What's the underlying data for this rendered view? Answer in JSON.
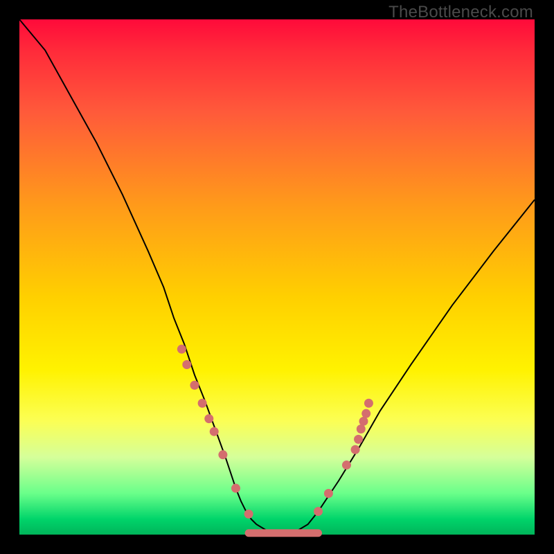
{
  "watermark": "TheBottleneck.com",
  "chart_data": {
    "type": "line",
    "title": "",
    "xlabel": "",
    "ylabel": "",
    "xlim": [
      0,
      100
    ],
    "ylim": [
      0,
      100
    ],
    "grid": false,
    "series": [
      {
        "name": "bottleneck-curve",
        "x": [
          0,
          5,
          10,
          15,
          20,
          25,
          28,
          30,
          32,
          34,
          36,
          38,
          40,
          41,
          42,
          43,
          44,
          45,
          46,
          48,
          50,
          52,
          54,
          56,
          58,
          62,
          66,
          70,
          76,
          84,
          92,
          100
        ],
        "y": [
          100,
          94,
          85,
          76,
          66,
          55,
          48,
          42,
          37,
          31,
          26,
          20.5,
          15,
          12,
          9,
          6.5,
          4.5,
          3,
          2,
          0.8,
          0.3,
          0.3,
          0.8,
          2,
          4.5,
          10.5,
          17,
          24,
          33,
          44.5,
          55,
          65
        ]
      }
    ],
    "markers": {
      "style": "dot",
      "color": "#d46e6e",
      "points": [
        {
          "x": 31.5,
          "y": 36
        },
        {
          "x": 32.5,
          "y": 33
        },
        {
          "x": 34.0,
          "y": 29
        },
        {
          "x": 35.5,
          "y": 25.5
        },
        {
          "x": 36.8,
          "y": 22.5
        },
        {
          "x": 37.8,
          "y": 20
        },
        {
          "x": 39.5,
          "y": 15.5
        },
        {
          "x": 42.0,
          "y": 9
        },
        {
          "x": 44.5,
          "y": 4
        },
        {
          "x": 58.0,
          "y": 4.5
        },
        {
          "x": 60.0,
          "y": 8
        },
        {
          "x": 63.5,
          "y": 13.5
        },
        {
          "x": 65.2,
          "y": 16.5
        },
        {
          "x": 65.8,
          "y": 18.5
        },
        {
          "x": 66.3,
          "y": 20.5
        },
        {
          "x": 66.8,
          "y": 22
        },
        {
          "x": 67.3,
          "y": 23.5
        },
        {
          "x": 67.8,
          "y": 25.5
        }
      ]
    },
    "baseline_segment": {
      "style": "thick-line",
      "color": "#d46e6e",
      "x0": 44.5,
      "x1": 58.0,
      "y": 0.3
    }
  }
}
